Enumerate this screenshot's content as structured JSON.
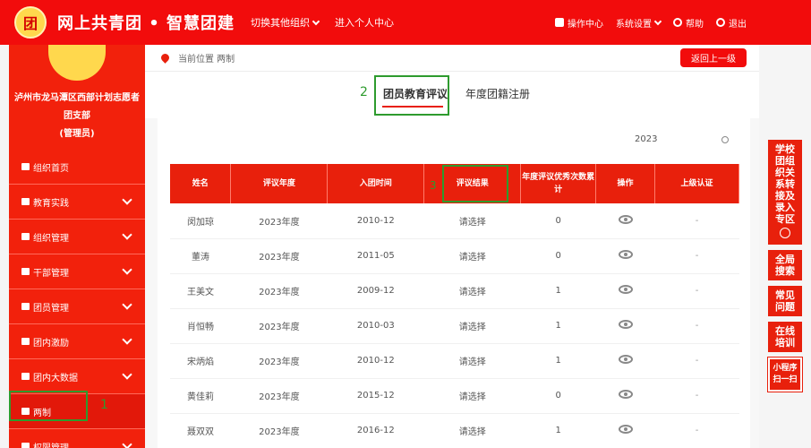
{
  "header": {
    "brand": "网上共青团 • 智慧团建",
    "switch_org": "切换其他组织",
    "personal_center": "进入个人中心",
    "operation_center": "操作中心",
    "system_settings": "系统设置",
    "help": "帮助",
    "logout": "退出",
    "accent": "#f20c0c"
  },
  "sidebar": {
    "org_name": "泸州市龙马潭区西部计划志愿者团支部",
    "role": "(管理员)",
    "home": "组织首页",
    "items": [
      {
        "label": "教育实践"
      },
      {
        "label": "组织管理"
      },
      {
        "label": "干部管理"
      },
      {
        "label": "团员管理"
      },
      {
        "label": "团内激励"
      },
      {
        "label": "团内大数据"
      },
      {
        "label": "两制"
      },
      {
        "label": "权限管理"
      }
    ]
  },
  "breadcrumb": {
    "text": "当前位置 两制",
    "back": "返回上一级"
  },
  "tabs": [
    {
      "label": "团员教育评议",
      "active": true
    },
    {
      "label": "年度团籍注册",
      "active": false
    }
  ],
  "filter": {
    "year": "2023"
  },
  "table": {
    "headers": [
      "姓名",
      "评议年度",
      "入团时间",
      "评议结果",
      "年度评议优秀次数累计",
      "操作",
      "上级认证"
    ],
    "rows": [
      {
        "name": "闵加琼",
        "year": "2023年度",
        "join": "2010-12",
        "result": "请选择",
        "count": "0",
        "cert": "-"
      },
      {
        "name": "董涛",
        "year": "2023年度",
        "join": "2011-05",
        "result": "请选择",
        "count": "0",
        "cert": "-"
      },
      {
        "name": "王美文",
        "year": "2023年度",
        "join": "2009-12",
        "result": "请选择",
        "count": "1",
        "cert": "-"
      },
      {
        "name": "肖恒畅",
        "year": "2023年度",
        "join": "2010-03",
        "result": "请选择",
        "count": "1",
        "cert": "-"
      },
      {
        "name": "宋炳焰",
        "year": "2023年度",
        "join": "2010-12",
        "result": "请选择",
        "count": "1",
        "cert": "-"
      },
      {
        "name": "黄佳莉",
        "year": "2023年度",
        "join": "2015-12",
        "result": "请选择",
        "count": "0",
        "cert": "-"
      },
      {
        "name": "聂双双",
        "year": "2023年度",
        "join": "2016-12",
        "result": "请选择",
        "count": "1",
        "cert": "-"
      }
    ]
  },
  "annotations": {
    "n1": "1",
    "n2": "2",
    "n3": "3"
  },
  "right_bar": [
    {
      "label": "学校团组织关系转接及录入专区"
    },
    {
      "label": "全局搜索"
    },
    {
      "label": "常见问题"
    },
    {
      "label": "在线培训"
    },
    {
      "label": "小程序扫一扫"
    }
  ]
}
